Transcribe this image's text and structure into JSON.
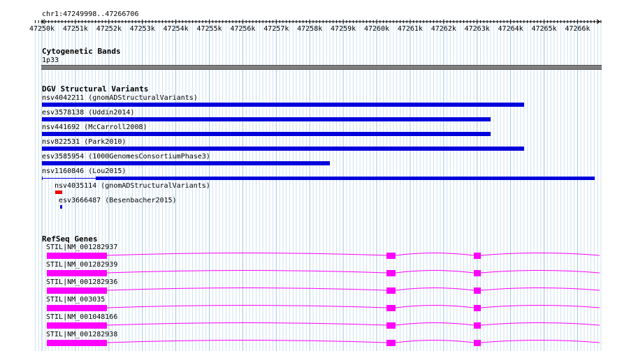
{
  "ruler": {
    "locus": "chr1:47249998..47266706",
    "ticks": [
      "47250k",
      "47251k",
      "47252k",
      "47253k",
      "47254k",
      "47255k",
      "47256k",
      "47257k",
      "47258k",
      "47259k",
      "47260k",
      "47261k",
      "47262k",
      "47263k",
      "47264k",
      "47265k",
      "47266k"
    ]
  },
  "tracks": {
    "cytoband": {
      "title": "Cytogenetic Bands",
      "band": "1p33"
    },
    "dgv": {
      "title": "DGV Structural Variants",
      "variants": [
        {
          "label": "nsv4042211 (gnomADStructuralVariants)",
          "start_kb": 47250.0,
          "end_kb": 47264.4,
          "color": "#0000dd"
        },
        {
          "label": "esv3578138 (Uddin2014)",
          "start_kb": 47250.0,
          "end_kb": 47263.4,
          "color": "#0000dd"
        },
        {
          "label": "nsv441692 (McCarroll2008)",
          "start_kb": 47250.0,
          "end_kb": 47263.4,
          "color": "#0000dd"
        },
        {
          "label": "nsv822531 (Park2010)",
          "start_kb": 47250.0,
          "end_kb": 47264.4,
          "color": "#0000dd"
        },
        {
          "label": "esv3585954 (1000GenomesConsortiumPhase3)",
          "start_kb": 47250.0,
          "end_kb": 47258.6,
          "color": "#0000dd"
        },
        {
          "label": "nsv1160846 (Lou2015)",
          "start_kb": 47250.0,
          "end_kb": 47266.5,
          "color": "#0000dd"
        },
        {
          "label": "nsv4035114 (gnomADStructuralVariants)",
          "start_kb": 47250.4,
          "end_kb": 47250.6,
          "color": "#ee0000"
        },
        {
          "label": "esv3666487 (Besenbacher2015)",
          "start_kb": 47250.55,
          "end_kb": 47250.6,
          "color": "#0000dd"
        }
      ]
    },
    "refseq": {
      "title": "RefSeq Genes",
      "color": "#ff00ff",
      "genes": [
        {
          "label": "STIL|NM_001282937"
        },
        {
          "label": "STIL|NM_001282939"
        },
        {
          "label": "STIL|NM_001282936"
        },
        {
          "label": "STIL|NM_003035"
        },
        {
          "label": "STIL|NM_001048166"
        },
        {
          "label": "STIL|NM_001282938"
        }
      ]
    }
  }
}
